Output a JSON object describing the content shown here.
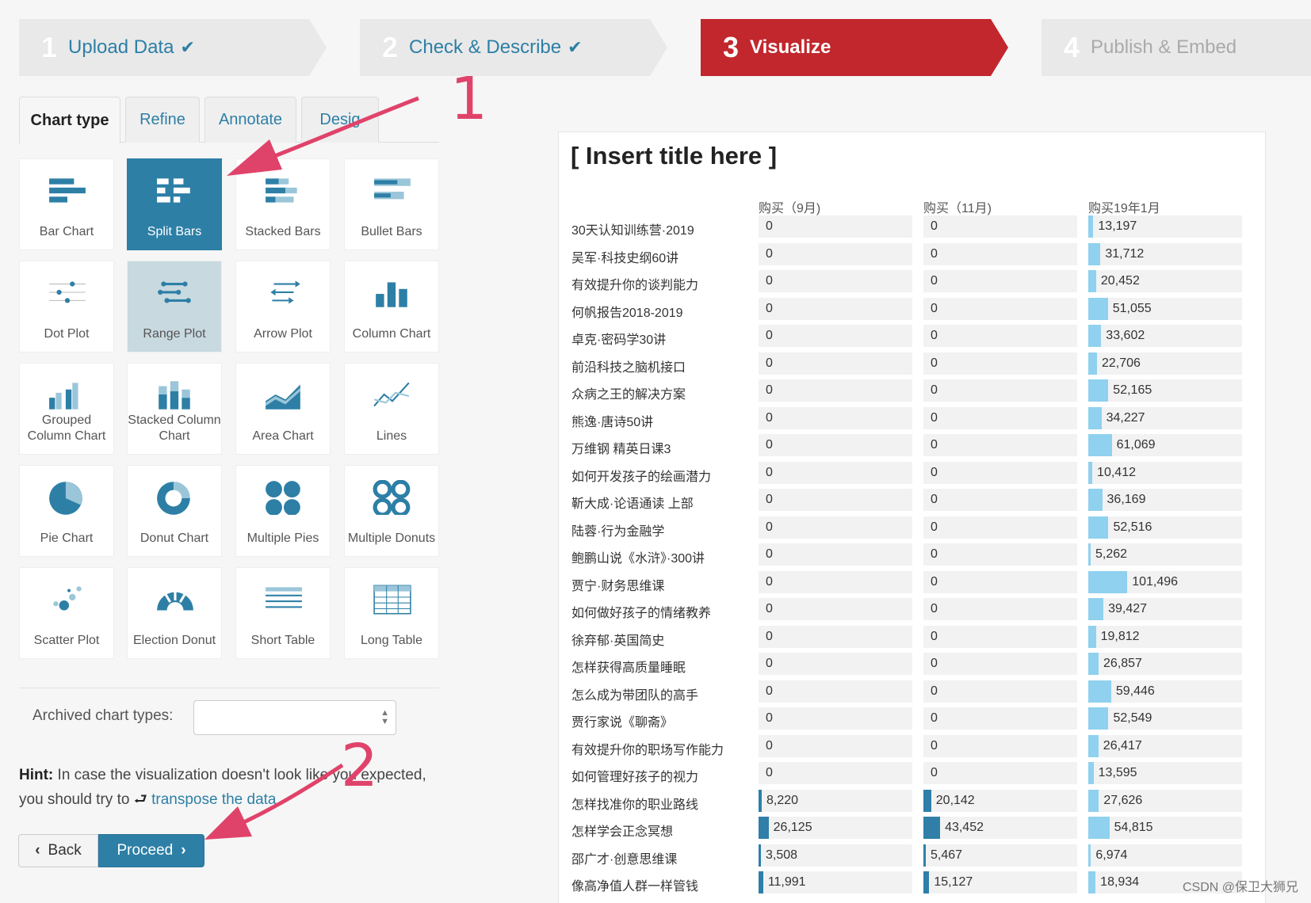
{
  "steps": [
    {
      "num": "1",
      "label": "Upload Data",
      "check": "✔",
      "state": "done"
    },
    {
      "num": "2",
      "label": "Check & Describe",
      "check": "✔",
      "state": "done"
    },
    {
      "num": "3",
      "label": "Visualize",
      "check": "",
      "state": "active"
    },
    {
      "num": "4",
      "label": "Publish & Embed",
      "check": "",
      "state": "todo"
    }
  ],
  "tabs": [
    "Chart type",
    "Refine",
    "Annotate",
    "Desig"
  ],
  "chart_types": [
    "Bar Chart",
    "Split Bars",
    "Stacked Bars",
    "Bullet Bars",
    "Dot Plot",
    "Range Plot",
    "Arrow Plot",
    "Column Chart",
    "Grouped Column Chart",
    "Stacked Column Chart",
    "Area Chart",
    "Lines",
    "Pie Chart",
    "Donut Chart",
    "Multiple Pies",
    "Multiple Donuts",
    "Scatter Plot",
    "Election Donut",
    "Short Table",
    "Long Table"
  ],
  "selected_chart_type": "Split Bars",
  "archived": {
    "label": "Archived chart types:",
    "value": ""
  },
  "hint": {
    "bold": "Hint:",
    "text1": " In case the visualization doesn't look like you expected, you should try to ",
    "link": "transpose the data"
  },
  "buttons": {
    "back": "Back",
    "proceed": "Proceed"
  },
  "annotations": {
    "one": "1",
    "two": "2"
  },
  "colors": {
    "accent": "#2d7fa6",
    "active_step": "#c1272d",
    "arrow": "#e0436a",
    "bar_dark": "#2f7fa8",
    "bar_light": "#8fd1ee"
  },
  "watermark": "CSDN @保卫大狮兄",
  "chart_data": {
    "type": "bar",
    "title": "[ Insert title here ]",
    "columns": [
      "购买（9月)",
      "购买（11月)",
      "购买19年1月"
    ],
    "categories": [
      "30天认知训练营·2019",
      "吴军·科技史纲60讲",
      "有效提升你的谈判能力",
      "何帆报告2018-2019",
      "卓克·密码学30讲",
      "前沿科技之脑机接口",
      "众病之王的解决方案",
      "熊逸·唐诗50讲",
      "万维钢 精英日课3",
      "如何开发孩子的绘画潜力",
      "靳大成·论语通读 上部",
      "陆蓉·行为金融学",
      "鲍鹏山说《水浒》·300讲",
      "贾宁·财务思维课",
      "如何做好孩子的情绪教养",
      "徐弃郁·英国简史",
      "怎样获得高质量睡眠",
      "怎么成为带团队的高手",
      "贾行家说《聊斋》",
      "有效提升你的职场写作能力",
      "如何管理好孩子的视力",
      "怎样找准你的职业路线",
      "怎样学会正念冥想",
      "邵广才·创意思维课",
      "像高净值人群一样管钱"
    ],
    "series": [
      {
        "name": "购买（9月)",
        "values": [
          0,
          0,
          0,
          0,
          0,
          0,
          0,
          0,
          0,
          0,
          0,
          0,
          0,
          0,
          0,
          0,
          0,
          0,
          0,
          0,
          0,
          8220,
          26125,
          3508,
          11991
        ]
      },
      {
        "name": "购买（11月)",
        "values": [
          0,
          0,
          0,
          0,
          0,
          0,
          0,
          0,
          0,
          0,
          0,
          0,
          0,
          0,
          0,
          0,
          0,
          0,
          0,
          0,
          0,
          20142,
          43452,
          5467,
          15127
        ]
      },
      {
        "name": "购买19年1月",
        "values": [
          13197,
          31712,
          20452,
          51055,
          33602,
          22706,
          52165,
          34227,
          61069,
          10412,
          36169,
          52516,
          5262,
          101496,
          39427,
          19812,
          26857,
          59446,
          52549,
          26417,
          13595,
          27626,
          54815,
          6974,
          18934
        ]
      }
    ],
    "display_values": [
      [
        "0",
        "0",
        "13,197"
      ],
      [
        "0",
        "0",
        "31,712"
      ],
      [
        "0",
        "0",
        "20,452"
      ],
      [
        "0",
        "0",
        "51,055"
      ],
      [
        "0",
        "0",
        "33,602"
      ],
      [
        "0",
        "0",
        "22,706"
      ],
      [
        "0",
        "0",
        "52,165"
      ],
      [
        "0",
        "0",
        "34,227"
      ],
      [
        "0",
        "0",
        "61,069"
      ],
      [
        "0",
        "0",
        "10,412"
      ],
      [
        "0",
        "0",
        "36,169"
      ],
      [
        "0",
        "0",
        "52,516"
      ],
      [
        "0",
        "0",
        "5,262"
      ],
      [
        "0",
        "0",
        "101,496"
      ],
      [
        "0",
        "0",
        "39,427"
      ],
      [
        "0",
        "0",
        "19,812"
      ],
      [
        "0",
        "0",
        "26,857"
      ],
      [
        "0",
        "0",
        "59,446"
      ],
      [
        "0",
        "0",
        "52,549"
      ],
      [
        "0",
        "0",
        "26,417"
      ],
      [
        "0",
        "0",
        "13,595"
      ],
      [
        "8,220",
        "20,142",
        "27,626"
      ],
      [
        "26,125",
        "43,452",
        "54,815"
      ],
      [
        "3,508",
        "5,467",
        "6,974"
      ],
      [
        "11,991",
        "15,127",
        "18,934"
      ]
    ],
    "xlim": [
      0,
      400000
    ]
  }
}
